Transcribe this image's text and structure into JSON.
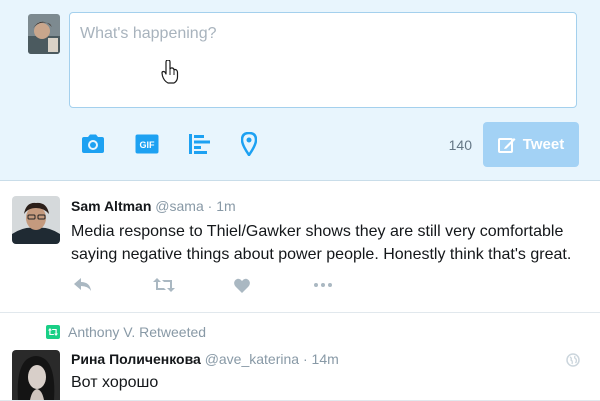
{
  "composer": {
    "placeholder": "What's happening?",
    "char_count": "140",
    "tweet_button_label": "Tweet",
    "tools": [
      "camera-icon",
      "gif-icon",
      "poll-icon",
      "location-icon"
    ]
  },
  "timeline": {
    "tweets": [
      {
        "fullname": "Sam Altman",
        "handle": "@sama",
        "separator": "·",
        "time": "1m",
        "text": "Media response to Thiel/Gawker shows they are still very comfortable saying negative things about power people. Honestly think that's great.",
        "actions": [
          "reply-icon",
          "retweet-icon",
          "like-icon",
          "more-icon"
        ]
      },
      {
        "context": "Anthony V. Retweeted",
        "fullname": "Рина Поличенкова",
        "handle": "@ave_katerina",
        "separator": "·",
        "time": "14m",
        "text": "Вот хорошо"
      }
    ]
  },
  "colors": {
    "accent": "#1da1f2",
    "composer_bg": "#e8f5fd",
    "tweet_button_disabled": "#a3d2f5",
    "retweet_green": "#19cf86",
    "muted_text": "#8899a6"
  }
}
